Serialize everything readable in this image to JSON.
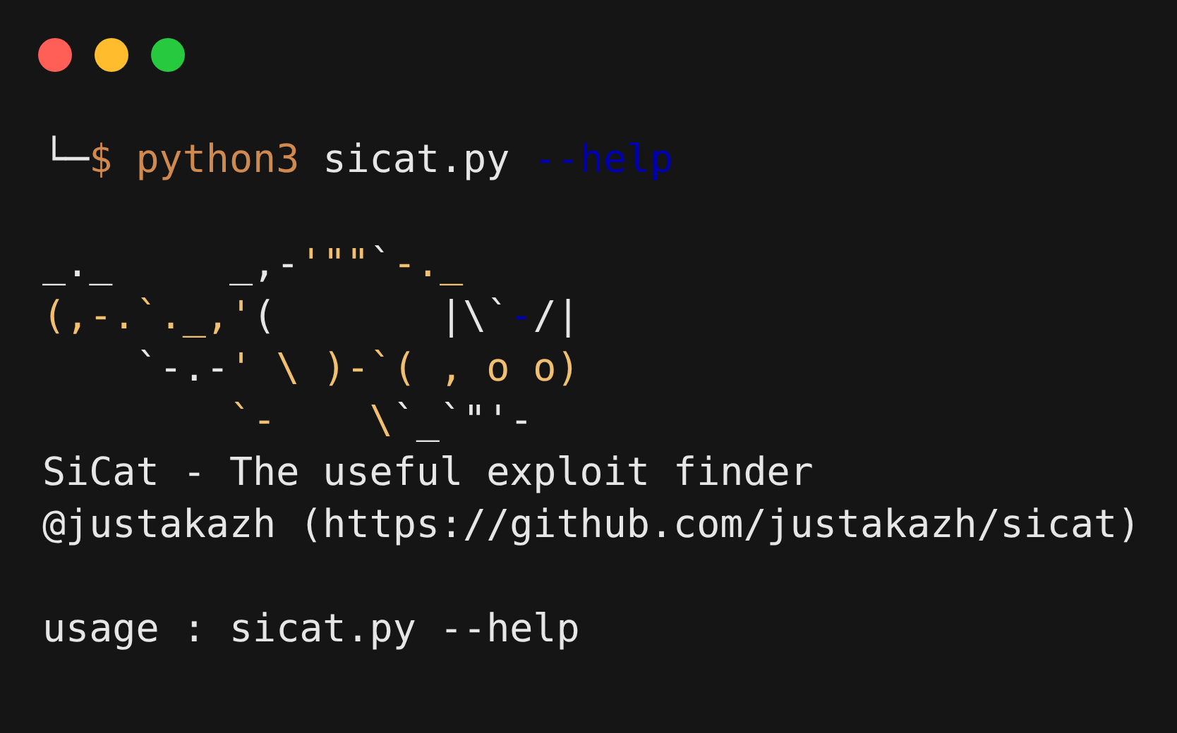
{
  "window": {
    "buttons": [
      {
        "color": "#ff5f56"
      },
      {
        "color": "#ffbd2e"
      },
      {
        "color": "#27c93f"
      }
    ]
  },
  "lines": [
    {
      "kind": "prompt",
      "segments": [
        {
          "text": "└─",
          "color": "#e6e6e6"
        },
        {
          "text": "$ python3",
          "color": "#d08a50"
        },
        {
          "text": " sicat.py ",
          "color": "#e6e6e6"
        },
        {
          "text": "--help",
          "color": "#0000b0"
        }
      ]
    },
    {
      "kind": "blank"
    },
    {
      "kind": "art",
      "segments": [
        {
          "text": "_._     _,-",
          "color": "#e6e6e6"
        },
        {
          "text": "'\"\"",
          "color": "#f0c070"
        },
        {
          "text": "`",
          "color": "#e6e6e6"
        },
        {
          "text": "-._",
          "color": "#f0c070"
        }
      ]
    },
    {
      "kind": "art",
      "segments": [
        {
          "text": "(,-.`._,'",
          "color": "#f0c070"
        },
        {
          "text": "(       |\\`",
          "color": "#e6e6e6"
        },
        {
          "text": "-",
          "color": "#0000b0"
        },
        {
          "text": "/|",
          "color": "#e6e6e6"
        }
      ]
    },
    {
      "kind": "art",
      "segments": [
        {
          "text": "    `-.-",
          "color": "#e6e6e6"
        },
        {
          "text": "' \\ )-`( , o o)",
          "color": "#f0c070"
        }
      ]
    },
    {
      "kind": "art",
      "segments": [
        {
          "text": "        `-    \\",
          "color": "#f0c070"
        },
        {
          "text": "`_`\"'-",
          "color": "#e6e6e6"
        }
      ]
    },
    {
      "kind": "output",
      "text": "SiCat - The useful exploit finder"
    },
    {
      "kind": "output",
      "text": "@justakazh (https://github.com/justakazh/sicat)"
    },
    {
      "kind": "blank"
    },
    {
      "kind": "output",
      "text": "usage : sicat.py --help"
    }
  ]
}
